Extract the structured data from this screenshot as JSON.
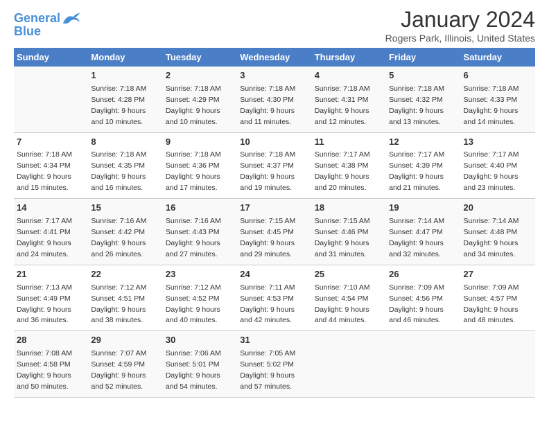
{
  "header": {
    "logo_line1": "General",
    "logo_line2": "Blue",
    "title": "January 2024",
    "subtitle": "Rogers Park, Illinois, United States"
  },
  "weekdays": [
    "Sunday",
    "Monday",
    "Tuesday",
    "Wednesday",
    "Thursday",
    "Friday",
    "Saturday"
  ],
  "weeks": [
    [
      {
        "day": "",
        "content": ""
      },
      {
        "day": "1",
        "content": "Sunrise: 7:18 AM\nSunset: 4:28 PM\nDaylight: 9 hours\nand 10 minutes."
      },
      {
        "day": "2",
        "content": "Sunrise: 7:18 AM\nSunset: 4:29 PM\nDaylight: 9 hours\nand 10 minutes."
      },
      {
        "day": "3",
        "content": "Sunrise: 7:18 AM\nSunset: 4:30 PM\nDaylight: 9 hours\nand 11 minutes."
      },
      {
        "day": "4",
        "content": "Sunrise: 7:18 AM\nSunset: 4:31 PM\nDaylight: 9 hours\nand 12 minutes."
      },
      {
        "day": "5",
        "content": "Sunrise: 7:18 AM\nSunset: 4:32 PM\nDaylight: 9 hours\nand 13 minutes."
      },
      {
        "day": "6",
        "content": "Sunrise: 7:18 AM\nSunset: 4:33 PM\nDaylight: 9 hours\nand 14 minutes."
      }
    ],
    [
      {
        "day": "7",
        "content": "Sunrise: 7:18 AM\nSunset: 4:34 PM\nDaylight: 9 hours\nand 15 minutes."
      },
      {
        "day": "8",
        "content": "Sunrise: 7:18 AM\nSunset: 4:35 PM\nDaylight: 9 hours\nand 16 minutes."
      },
      {
        "day": "9",
        "content": "Sunrise: 7:18 AM\nSunset: 4:36 PM\nDaylight: 9 hours\nand 17 minutes."
      },
      {
        "day": "10",
        "content": "Sunrise: 7:18 AM\nSunset: 4:37 PM\nDaylight: 9 hours\nand 19 minutes."
      },
      {
        "day": "11",
        "content": "Sunrise: 7:17 AM\nSunset: 4:38 PM\nDaylight: 9 hours\nand 20 minutes."
      },
      {
        "day": "12",
        "content": "Sunrise: 7:17 AM\nSunset: 4:39 PM\nDaylight: 9 hours\nand 21 minutes."
      },
      {
        "day": "13",
        "content": "Sunrise: 7:17 AM\nSunset: 4:40 PM\nDaylight: 9 hours\nand 23 minutes."
      }
    ],
    [
      {
        "day": "14",
        "content": "Sunrise: 7:17 AM\nSunset: 4:41 PM\nDaylight: 9 hours\nand 24 minutes."
      },
      {
        "day": "15",
        "content": "Sunrise: 7:16 AM\nSunset: 4:42 PM\nDaylight: 9 hours\nand 26 minutes."
      },
      {
        "day": "16",
        "content": "Sunrise: 7:16 AM\nSunset: 4:43 PM\nDaylight: 9 hours\nand 27 minutes."
      },
      {
        "day": "17",
        "content": "Sunrise: 7:15 AM\nSunset: 4:45 PM\nDaylight: 9 hours\nand 29 minutes."
      },
      {
        "day": "18",
        "content": "Sunrise: 7:15 AM\nSunset: 4:46 PM\nDaylight: 9 hours\nand 31 minutes."
      },
      {
        "day": "19",
        "content": "Sunrise: 7:14 AM\nSunset: 4:47 PM\nDaylight: 9 hours\nand 32 minutes."
      },
      {
        "day": "20",
        "content": "Sunrise: 7:14 AM\nSunset: 4:48 PM\nDaylight: 9 hours\nand 34 minutes."
      }
    ],
    [
      {
        "day": "21",
        "content": "Sunrise: 7:13 AM\nSunset: 4:49 PM\nDaylight: 9 hours\nand 36 minutes."
      },
      {
        "day": "22",
        "content": "Sunrise: 7:12 AM\nSunset: 4:51 PM\nDaylight: 9 hours\nand 38 minutes."
      },
      {
        "day": "23",
        "content": "Sunrise: 7:12 AM\nSunset: 4:52 PM\nDaylight: 9 hours\nand 40 minutes."
      },
      {
        "day": "24",
        "content": "Sunrise: 7:11 AM\nSunset: 4:53 PM\nDaylight: 9 hours\nand 42 minutes."
      },
      {
        "day": "25",
        "content": "Sunrise: 7:10 AM\nSunset: 4:54 PM\nDaylight: 9 hours\nand 44 minutes."
      },
      {
        "day": "26",
        "content": "Sunrise: 7:09 AM\nSunset: 4:56 PM\nDaylight: 9 hours\nand 46 minutes."
      },
      {
        "day": "27",
        "content": "Sunrise: 7:09 AM\nSunset: 4:57 PM\nDaylight: 9 hours\nand 48 minutes."
      }
    ],
    [
      {
        "day": "28",
        "content": "Sunrise: 7:08 AM\nSunset: 4:58 PM\nDaylight: 9 hours\nand 50 minutes."
      },
      {
        "day": "29",
        "content": "Sunrise: 7:07 AM\nSunset: 4:59 PM\nDaylight: 9 hours\nand 52 minutes."
      },
      {
        "day": "30",
        "content": "Sunrise: 7:06 AM\nSunset: 5:01 PM\nDaylight: 9 hours\nand 54 minutes."
      },
      {
        "day": "31",
        "content": "Sunrise: 7:05 AM\nSunset: 5:02 PM\nDaylight: 9 hours\nand 57 minutes."
      },
      {
        "day": "",
        "content": ""
      },
      {
        "day": "",
        "content": ""
      },
      {
        "day": "",
        "content": ""
      }
    ]
  ]
}
